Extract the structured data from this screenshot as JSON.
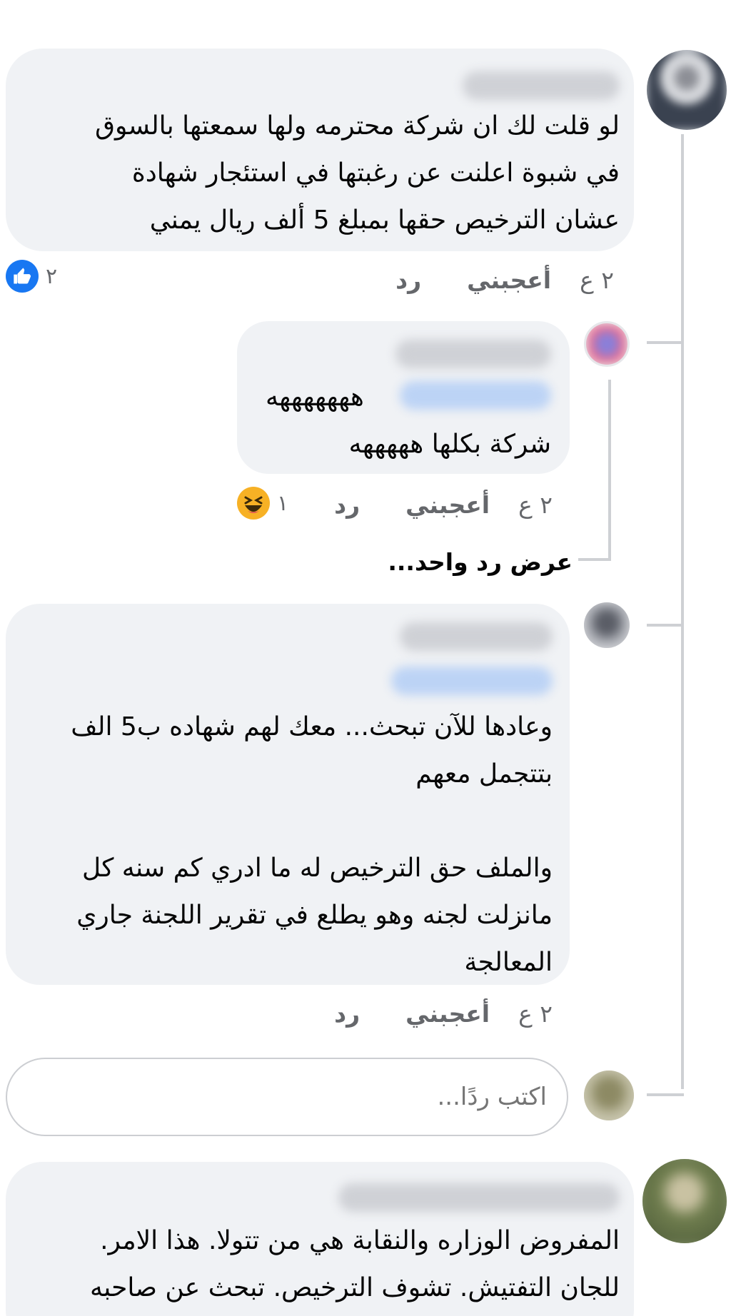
{
  "comments": [
    {
      "text": "لو قلت لك ان شركة محترمه ولها سمعتها بالسوق\nفي شبوة اعلنت عن رغبتها في استئجار شهادة\nعشان الترخيص حقها بمبلغ 5 ألف ريال يمني",
      "time": "٢ ع",
      "like_label": "أعجبني",
      "reply_label": "رد",
      "reaction_count": "٢",
      "reaction_icon": "like-icon"
    },
    {
      "mention_line": "هههههههه",
      "text": "شركة بكلها هههههه",
      "time": "٢ ع",
      "like_label": "أعجبني",
      "reply_label": "رد",
      "reaction_count": "١",
      "reaction_icon": "haha-icon"
    },
    {
      "text": "وعادها للآن تبحث... معك لهم شهاده ب5 الف\nبتتجمل معهم\n\nوالملف حق الترخيص له ما ادري كم سنه كل\nمانزلت لجنه وهو يطلع في تقرير اللجنة جاري\nالمعالجة",
      "time": "٢ ع",
      "like_label": "أعجبني",
      "reply_label": "رد"
    },
    {
      "text": "المفروض الوزاره والنقابة هي من تتولا. هذا الامر.\nللجان التفتيش. تشوف الترخيص. تبحث عن صاحبه"
    }
  ],
  "view_more_replies": "عرض رد واحد...",
  "reply_input": {
    "placeholder": "اكتب ردًا..."
  },
  "colors": {
    "bubble": "#f0f2f5",
    "meta_text": "#65676b",
    "like_blue": "#1877f2",
    "haha_yellow": "#f7b125",
    "thread_line": "#ced0d4"
  }
}
